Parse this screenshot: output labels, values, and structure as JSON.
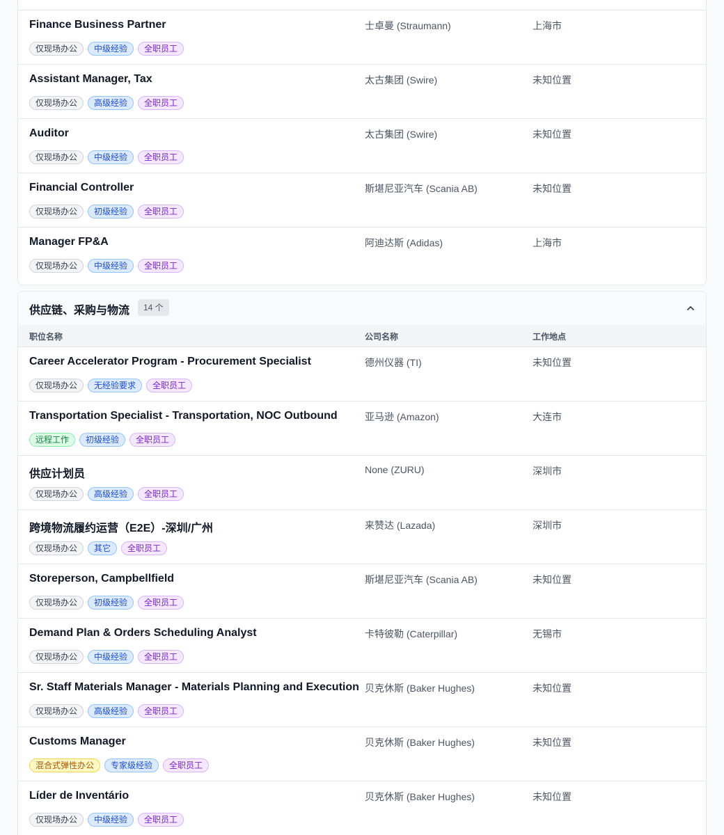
{
  "section_a": {
    "rows": [
      {
        "title": "Finance Business Partner",
        "company": "士卓曼 (Straumann)",
        "location": "上海市",
        "tags": [
          {
            "text": "仅现场办公",
            "kind": "gray"
          },
          {
            "text": "中级经验",
            "kind": "blue"
          },
          {
            "text": "全职员工",
            "kind": "purple"
          }
        ]
      },
      {
        "title": "Assistant Manager, Tax",
        "company": "太古集团 (Swire)",
        "location": "未知位置",
        "tags": [
          {
            "text": "仅现场办公",
            "kind": "gray"
          },
          {
            "text": "高级经验",
            "kind": "blue"
          },
          {
            "text": "全职员工",
            "kind": "purple"
          }
        ]
      },
      {
        "title": "Auditor",
        "company": "太古集团 (Swire)",
        "location": "未知位置",
        "tags": [
          {
            "text": "仅现场办公",
            "kind": "gray"
          },
          {
            "text": "中级经验",
            "kind": "blue"
          },
          {
            "text": "全职员工",
            "kind": "purple"
          }
        ]
      },
      {
        "title": "Financial Controller",
        "company": "斯堪尼亚汽车 (Scania AB)",
        "location": "未知位置",
        "tags": [
          {
            "text": "仅现场办公",
            "kind": "gray"
          },
          {
            "text": "初级经验",
            "kind": "blue"
          },
          {
            "text": "全职员工",
            "kind": "purple"
          }
        ]
      },
      {
        "title": "Manager FP&A",
        "company": "阿迪达斯 (Adidas)",
        "location": "上海市",
        "tags": [
          {
            "text": "仅现场办公",
            "kind": "gray"
          },
          {
            "text": "中级经验",
            "kind": "blue"
          },
          {
            "text": "全职员工",
            "kind": "purple"
          }
        ]
      }
    ]
  },
  "section_b": {
    "title": "供应链、采购与物流",
    "count": "14 个",
    "columns": {
      "title": "职位名称",
      "company": "公司名称",
      "location": "工作地点"
    },
    "rows": [
      {
        "title": "Career Accelerator Program - Procurement Specialist",
        "company": "德州仪器 (TI)",
        "location": "未知位置",
        "tags": [
          {
            "text": "仅现场办公",
            "kind": "gray"
          },
          {
            "text": "无经验要求",
            "kind": "blue"
          },
          {
            "text": "全职员工",
            "kind": "purple"
          }
        ]
      },
      {
        "title": "Transportation Specialist - Transportation, NOC Outbound",
        "company": "亚马逊 (Amazon)",
        "location": "大连市",
        "tags": [
          {
            "text": "远程工作",
            "kind": "green"
          },
          {
            "text": "初级经验",
            "kind": "blue"
          },
          {
            "text": "全职员工",
            "kind": "purple"
          }
        ]
      },
      {
        "title": "供应计划员",
        "company": "None (ZURU)",
        "location": "深圳市",
        "tags": [
          {
            "text": "仅现场办公",
            "kind": "gray"
          },
          {
            "text": "高级经验",
            "kind": "blue"
          },
          {
            "text": "全职员工",
            "kind": "purple"
          }
        ]
      },
      {
        "title": "跨境物流履约运营（E2E）-深圳/广州",
        "company": "来赞达 (Lazada)",
        "location": "深圳市",
        "tags": [
          {
            "text": "仅现场办公",
            "kind": "gray"
          },
          {
            "text": "其它",
            "kind": "blue"
          },
          {
            "text": "全职员工",
            "kind": "purple"
          }
        ]
      },
      {
        "title": "Storeperson, Campbellfield",
        "company": "斯堪尼亚汽车 (Scania AB)",
        "location": "未知位置",
        "tags": [
          {
            "text": "仅现场办公",
            "kind": "gray"
          },
          {
            "text": "初级经验",
            "kind": "blue"
          },
          {
            "text": "全职员工",
            "kind": "purple"
          }
        ]
      },
      {
        "title": "Demand Plan & Orders Scheduling Analyst",
        "company": "卡特彼勒 (Caterpillar)",
        "location": "无锡市",
        "tags": [
          {
            "text": "仅现场办公",
            "kind": "gray"
          },
          {
            "text": "中级经验",
            "kind": "blue"
          },
          {
            "text": "全职员工",
            "kind": "purple"
          }
        ]
      },
      {
        "title": "Sr. Staff Materials Manager - Materials Planning and Execution",
        "company": "贝克休斯 (Baker Hughes)",
        "location": "未知位置",
        "tags": [
          {
            "text": "仅现场办公",
            "kind": "gray"
          },
          {
            "text": "高级经验",
            "kind": "blue"
          },
          {
            "text": "全职员工",
            "kind": "purple"
          }
        ]
      },
      {
        "title": "Customs Manager",
        "company": "贝克休斯 (Baker Hughes)",
        "location": "未知位置",
        "tags": [
          {
            "text": "混合式弹性办公",
            "kind": "amber"
          },
          {
            "text": "专家级经验",
            "kind": "blue"
          },
          {
            "text": "全职员工",
            "kind": "purple"
          }
        ]
      },
      {
        "title": "Líder de Inventário",
        "company": "贝克休斯 (Baker Hughes)",
        "location": "未知位置",
        "tags": [
          {
            "text": "仅现场办公",
            "kind": "gray"
          },
          {
            "text": "中级经验",
            "kind": "blue"
          },
          {
            "text": "全职员工",
            "kind": "purple"
          }
        ]
      }
    ]
  },
  "icons": {
    "collapse": "chevron-up-icon"
  },
  "colors": {
    "tag_gray": "#f3f4f6",
    "tag_blue": "#dbeafe",
    "tag_purple": "#f3e8ff",
    "tag_green": "#dcfce7",
    "tag_amber": "#fef9c3"
  }
}
